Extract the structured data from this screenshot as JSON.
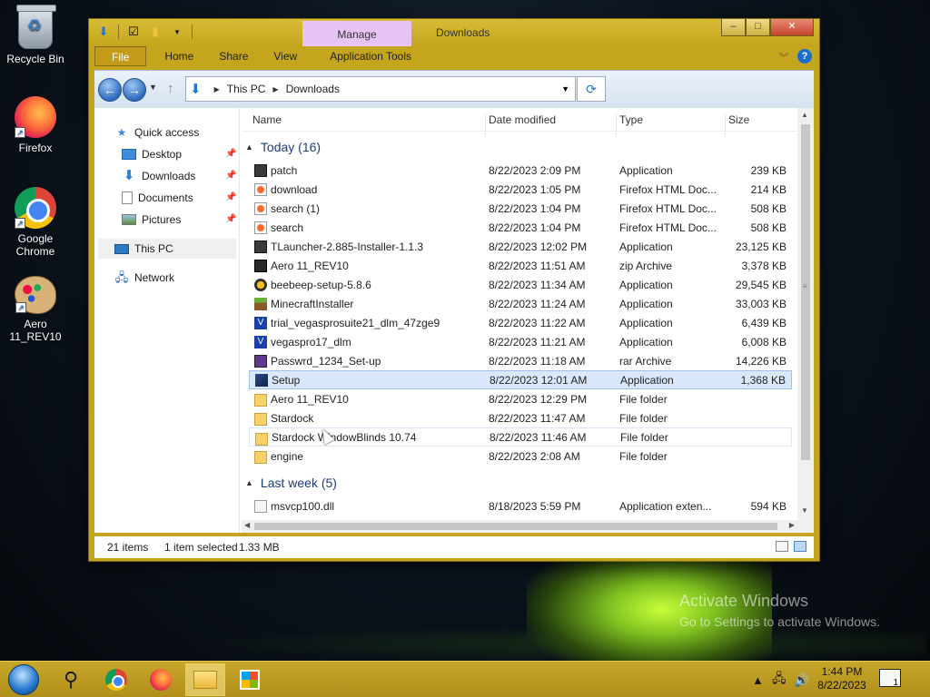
{
  "desktop": {
    "icons": [
      {
        "label": "Recycle Bin"
      },
      {
        "label": "Firefox"
      },
      {
        "label": "Google Chrome"
      },
      {
        "label": "Aero 11_REV10"
      }
    ],
    "watermark": {
      "line1": "Activate Windows",
      "line2": "Go to Settings to activate Windows."
    }
  },
  "window": {
    "title": "Downloads",
    "context_tab": "Manage",
    "controls": {
      "minimize": "–",
      "maximize": "□",
      "close": "✕"
    },
    "ribbon_tabs": [
      "File",
      "Home",
      "Share",
      "View",
      "Application Tools"
    ],
    "help": "?",
    "address": {
      "crumbs": [
        "This PC",
        "Downloads"
      ]
    },
    "nav_pane": {
      "quick_access": "Quick access",
      "items": [
        {
          "label": "Desktop",
          "pinned": true
        },
        {
          "label": "Downloads",
          "pinned": true
        },
        {
          "label": "Documents",
          "pinned": true
        },
        {
          "label": "Pictures",
          "pinned": true
        }
      ],
      "this_pc": "This PC",
      "network": "Network"
    },
    "columns": {
      "name": "Name",
      "date": "Date modified",
      "type": "Type",
      "size": "Size"
    },
    "groups": [
      {
        "label": "Today (16)",
        "rows": [
          {
            "name": "patch",
            "date": "8/22/2023 2:09 PM",
            "type": "Application",
            "size": "239 KB",
            "icon": "app"
          },
          {
            "name": "download",
            "date": "8/22/2023 1:05 PM",
            "type": "Firefox HTML Doc...",
            "size": "214 KB",
            "icon": "ff"
          },
          {
            "name": "search (1)",
            "date": "8/22/2023 1:04 PM",
            "type": "Firefox HTML Doc...",
            "size": "508 KB",
            "icon": "ff"
          },
          {
            "name": "search",
            "date": "8/22/2023 1:04 PM",
            "type": "Firefox HTML Doc...",
            "size": "508 KB",
            "icon": "ff"
          },
          {
            "name": "TLauncher-2.885-Installer-1.1.3",
            "date": "8/22/2023 12:02 PM",
            "type": "Application",
            "size": "23,125 KB",
            "icon": "app"
          },
          {
            "name": "Aero 11_REV10",
            "date": "8/22/2023 11:51 AM",
            "type": "zip Archive",
            "size": "3,378 KB",
            "icon": "zip"
          },
          {
            "name": "beebeep-setup-5.8.6",
            "date": "8/22/2023 11:34 AM",
            "type": "Application",
            "size": "29,545 KB",
            "icon": "bee"
          },
          {
            "name": "MinecraftInstaller",
            "date": "8/22/2023 11:24 AM",
            "type": "Application",
            "size": "33,003 KB",
            "icon": "mc"
          },
          {
            "name": "trial_vegasprosuite21_dlm_47zge9",
            "date": "8/22/2023 11:22 AM",
            "type": "Application",
            "size": "6,439 KB",
            "icon": "v"
          },
          {
            "name": "vegaspro17_dlm",
            "date": "8/22/2023 11:21 AM",
            "type": "Application",
            "size": "6,008 KB",
            "icon": "v"
          },
          {
            "name": "Passwrd_1234_Set-up",
            "date": "8/22/2023 11:18 AM",
            "type": "rar Archive",
            "size": "14,226 KB",
            "icon": "rar"
          },
          {
            "name": "Setup",
            "date": "8/22/2023 12:01 AM",
            "type": "Application",
            "size": "1,368 KB",
            "icon": "setup",
            "selected": true
          },
          {
            "name": "Aero 11_REV10",
            "date": "8/22/2023 12:29 PM",
            "type": "File folder",
            "size": "",
            "icon": "folder"
          },
          {
            "name": "Stardock",
            "date": "8/22/2023 11:47 AM",
            "type": "File folder",
            "size": "",
            "icon": "folder"
          },
          {
            "name": "Stardock WindowBlinds 10.74",
            "date": "8/22/2023 11:46 AM",
            "type": "File folder",
            "size": "",
            "icon": "folder",
            "hover": true
          },
          {
            "name": "engine",
            "date": "8/22/2023 2:08 AM",
            "type": "File folder",
            "size": "",
            "icon": "folder"
          }
        ]
      },
      {
        "label": "Last week (5)",
        "rows": [
          {
            "name": "msvcp100.dll",
            "date": "8/18/2023 5:59 PM",
            "type": "Application exten...",
            "size": "594 KB",
            "icon": "dll"
          }
        ]
      }
    ],
    "status": {
      "items": "21 items",
      "selected": "1 item selected",
      "size": "1.33 MB"
    }
  },
  "taskbar": {
    "clock_time": "1:44 PM",
    "clock_date": "8/22/2023",
    "notification_count": "1"
  }
}
